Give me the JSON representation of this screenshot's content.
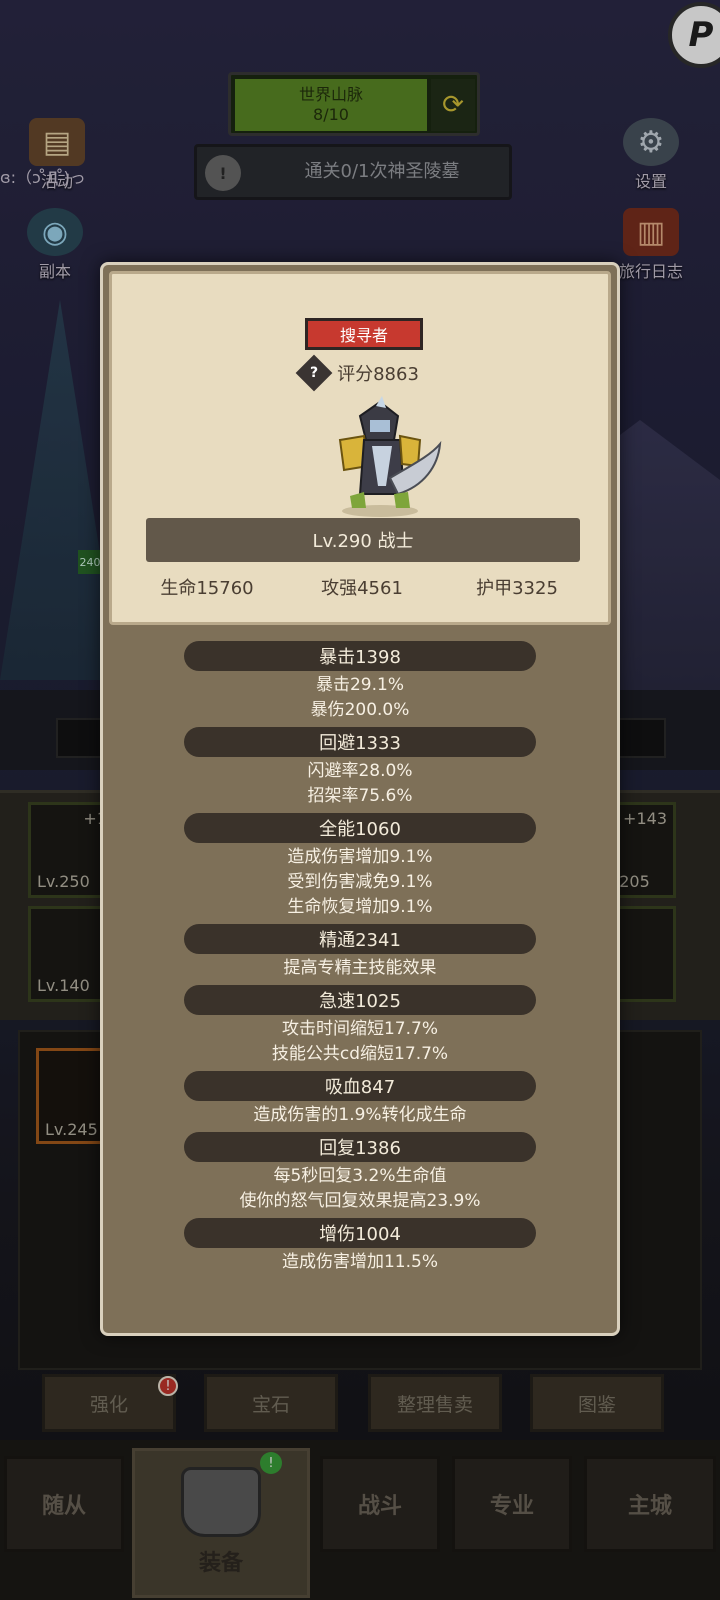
{
  "top_right_button": {
    "label": "P"
  },
  "stage": {
    "title": "世界山脉",
    "progress": "8/10",
    "switch_icon": "swap-arrows-icon"
  },
  "quest": {
    "icon": "!",
    "text": "通关0/1次神圣陵墓"
  },
  "left_menu": {
    "activity": {
      "label": "活动",
      "icon": "chest-icon"
    },
    "dungeon": {
      "label": "副本",
      "icon": "portal-icon"
    },
    "emote_text": "ɞ:（ɔ ̊Д ̊)っ"
  },
  "right_menu": {
    "settings": {
      "label": "设置",
      "icon": "gear-icon"
    },
    "journal": {
      "label": "旅行日志",
      "icon": "book-icon"
    }
  },
  "bg_equipment": {
    "slots": [
      {
        "plus": "+1",
        "level": "Lv.250"
      },
      {
        "plus": "",
        "level": "Lv.140"
      },
      {
        "plus": "+143",
        "level": "Lv.205"
      },
      {
        "plus": "",
        "level": ""
      }
    ],
    "selected_item": {
      "level": "Lv.245"
    },
    "left_marker": "240"
  },
  "function_buttons": [
    {
      "label": "强化",
      "badge": "!"
    },
    {
      "label": "宝石",
      "badge": ""
    },
    {
      "label": "整理售卖",
      "badge": ""
    },
    {
      "label": "图鉴",
      "badge": ""
    }
  ],
  "bottom_tabs": [
    {
      "label": "随从"
    },
    {
      "label": "装备",
      "active": true,
      "badge": "!"
    },
    {
      "label": "战斗"
    },
    {
      "label": "专业"
    },
    {
      "label": "主城"
    }
  ],
  "character_panel": {
    "role_tag": "搜寻者",
    "score": "评分8863",
    "help_icon": "?",
    "level_class": "Lv.290 战士",
    "base_stats": {
      "hp": "生命15760",
      "atk": "攻强4561",
      "armor": "护甲3325"
    },
    "attributes": [
      {
        "name": "暴击1398",
        "effects": [
          "暴击29.1%",
          "暴伤200.0%"
        ]
      },
      {
        "name": "回避1333",
        "effects": [
          "闪避率28.0%",
          "招架率75.6%"
        ]
      },
      {
        "name": "全能1060",
        "effects": [
          "造成伤害增加9.1%",
          "受到伤害减免9.1%",
          "生命恢复增加9.1%"
        ]
      },
      {
        "name": "精通2341",
        "effects": [
          "提高专精主技能效果"
        ]
      },
      {
        "name": "急速1025",
        "effects": [
          "攻击时间缩短17.7%",
          "技能公共cd缩短17.7%"
        ]
      },
      {
        "name": "吸血847",
        "effects": [
          "造成伤害的1.9%转化成生命"
        ]
      },
      {
        "name": "回复1386",
        "effects": [
          "每5秒回复3.2%生命值",
          "使你的怒气回复效果提高23.9%"
        ]
      },
      {
        "name": "增伤1004",
        "effects": [
          "造成伤害增加11.5%"
        ]
      }
    ]
  },
  "colors": {
    "role_tag": "#c7392f",
    "stage_bar": "#5c8a26",
    "panel_top": "#e8dcc0",
    "panel_body": "#7e7058"
  }
}
